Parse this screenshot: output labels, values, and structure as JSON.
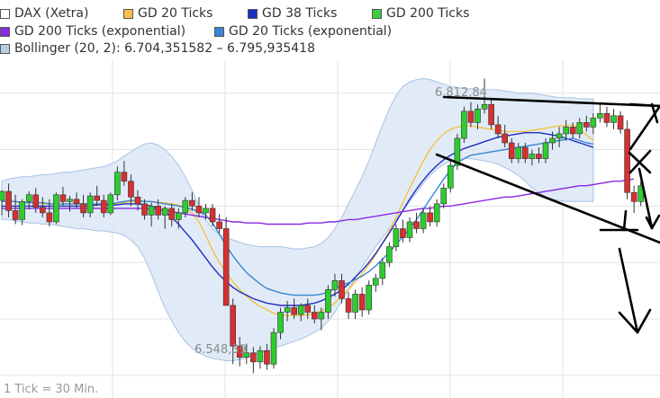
{
  "legend": {
    "items": [
      {
        "label": "DAX (Xetra)",
        "color": "#ffffff"
      },
      {
        "label": "GD 20 Ticks",
        "color": "#f5c243"
      },
      {
        "label": "GD 38 Ticks",
        "color": "#1f2ec4"
      },
      {
        "label": "GD 200 Ticks",
        "color": "#3fcc3f"
      },
      {
        "label": "GD 200 Ticks (exponential)",
        "color": "#8a2be2"
      },
      {
        "label": "GD 20 Ticks (exponential)",
        "color": "#3a86d4"
      },
      {
        "label": "Bollinger (20, 2): 6.704,351582 – 6.795,935418",
        "color": "#b7cde8"
      }
    ]
  },
  "annotations": {
    "high": "6.812,84",
    "low": "6.548,39"
  },
  "footer": {
    "tick_note": "1 Tick = 30 Min."
  },
  "chart_data": {
    "type": "candlestick",
    "title": "",
    "xlabel": "",
    "ylabel": "",
    "ylim": [
      6530,
      6830
    ],
    "grid": true,
    "legend_position": "top-left",
    "colors": {
      "up": "#2ecc2e",
      "down": "#d63030",
      "bollinger_fill": "#dbe7f6",
      "bollinger_edge": "#a9c2e4"
    },
    "candles": [
      [
        6705,
        6714,
        6692,
        6713
      ],
      [
        6713,
        6720,
        6690,
        6696
      ],
      [
        6696,
        6710,
        6684,
        6688
      ],
      [
        6688,
        6706,
        6683,
        6704
      ],
      [
        6704,
        6713,
        6697,
        6710
      ],
      [
        6710,
        6716,
        6694,
        6699
      ],
      [
        6699,
        6708,
        6690,
        6694
      ],
      [
        6694,
        6706,
        6682,
        6686
      ],
      [
        6686,
        6712,
        6684,
        6710
      ],
      [
        6710,
        6717,
        6700,
        6704
      ],
      [
        6704,
        6709,
        6695,
        6706
      ],
      [
        6706,
        6712,
        6698,
        6702
      ],
      [
        6702,
        6710,
        6690,
        6694
      ],
      [
        6694,
        6712,
        6690,
        6709
      ],
      [
        6709,
        6718,
        6700,
        6705
      ],
      [
        6705,
        6710,
        6690,
        6694
      ],
      [
        6694,
        6712,
        6692,
        6710
      ],
      [
        6710,
        6735,
        6705,
        6730
      ],
      [
        6730,
        6740,
        6718,
        6722
      ],
      [
        6722,
        6728,
        6700,
        6708
      ],
      [
        6708,
        6714,
        6696,
        6702
      ],
      [
        6702,
        6706,
        6688,
        6692
      ],
      [
        6692,
        6703,
        6682,
        6700
      ],
      [
        6700,
        6706,
        6688,
        6692
      ],
      [
        6692,
        6700,
        6680,
        6698
      ],
      [
        6698,
        6702,
        6682,
        6688
      ],
      [
        6688,
        6698,
        6680,
        6694
      ],
      [
        6694,
        6708,
        6690,
        6705
      ],
      [
        6705,
        6712,
        6696,
        6700
      ],
      [
        6700,
        6708,
        6690,
        6694
      ],
      [
        6694,
        6702,
        6688,
        6698
      ],
      [
        6698,
        6702,
        6682,
        6686
      ],
      [
        6686,
        6693,
        6676,
        6680
      ],
      [
        6680,
        6690,
        6640,
        6612
      ],
      [
        6612,
        6618,
        6560,
        6576
      ],
      [
        6576,
        6584,
        6558,
        6566
      ],
      [
        6566,
        6578,
        6560,
        6570
      ],
      [
        6570,
        6575,
        6552,
        6562
      ],
      [
        6562,
        6576,
        6556,
        6572
      ],
      [
        6572,
        6578,
        6555,
        6560
      ],
      [
        6560,
        6592,
        6556,
        6588
      ],
      [
        6588,
        6610,
        6582,
        6606
      ],
      [
        6606,
        6616,
        6598,
        6610
      ],
      [
        6610,
        6618,
        6600,
        6604
      ],
      [
        6604,
        6614,
        6598,
        6612
      ],
      [
        6612,
        6618,
        6600,
        6606
      ],
      [
        6606,
        6612,
        6596,
        6600
      ],
      [
        6600,
        6610,
        6590,
        6606
      ],
      [
        6606,
        6630,
        6600,
        6626
      ],
      [
        6626,
        6640,
        6620,
        6634
      ],
      [
        6634,
        6640,
        6614,
        6618
      ],
      [
        6618,
        6624,
        6600,
        6606
      ],
      [
        6606,
        6626,
        6600,
        6622
      ],
      [
        6622,
        6628,
        6602,
        6608
      ],
      [
        6608,
        6634,
        6604,
        6630
      ],
      [
        6630,
        6640,
        6624,
        6636
      ],
      [
        6636,
        6654,
        6630,
        6650
      ],
      [
        6650,
        6668,
        6646,
        6664
      ],
      [
        6664,
        6684,
        6660,
        6680
      ],
      [
        6680,
        6688,
        6668,
        6672
      ],
      [
        6672,
        6690,
        6668,
        6686
      ],
      [
        6686,
        6694,
        6676,
        6680
      ],
      [
        6680,
        6698,
        6676,
        6694
      ],
      [
        6694,
        6700,
        6682,
        6686
      ],
      [
        6686,
        6706,
        6682,
        6702
      ],
      [
        6702,
        6720,
        6698,
        6716
      ],
      [
        6716,
        6740,
        6712,
        6736
      ],
      [
        6736,
        6764,
        6732,
        6760
      ],
      [
        6760,
        6788,
        6756,
        6784
      ],
      [
        6784,
        6792,
        6770,
        6774
      ],
      [
        6774,
        6790,
        6768,
        6786
      ],
      [
        6786,
        6813,
        6782,
        6790
      ],
      [
        6790,
        6796,
        6768,
        6772
      ],
      [
        6772,
        6780,
        6760,
        6764
      ],
      [
        6764,
        6772,
        6752,
        6756
      ],
      [
        6756,
        6760,
        6738,
        6742
      ],
      [
        6742,
        6756,
        6738,
        6752
      ],
      [
        6752,
        6756,
        6738,
        6742
      ],
      [
        6742,
        6750,
        6736,
        6746
      ],
      [
        6746,
        6752,
        6738,
        6742
      ],
      [
        6742,
        6760,
        6738,
        6756
      ],
      [
        6756,
        6766,
        6750,
        6760
      ],
      [
        6760,
        6770,
        6752,
        6764
      ],
      [
        6764,
        6776,
        6758,
        6770
      ],
      [
        6770,
        6774,
        6760,
        6764
      ],
      [
        6764,
        6778,
        6760,
        6774
      ],
      [
        6774,
        6780,
        6766,
        6770
      ],
      [
        6770,
        6782,
        6764,
        6778
      ],
      [
        6778,
        6790,
        6774,
        6782
      ],
      [
        6782,
        6788,
        6770,
        6774
      ],
      [
        6774,
        6786,
        6768,
        6780
      ],
      [
        6780,
        6784,
        6764,
        6768
      ],
      [
        6768,
        6776,
        6706,
        6712
      ],
      [
        6712,
        6718,
        6694,
        6704
      ],
      [
        6704,
        6722,
        6700,
        6718
      ]
    ],
    "series": [
      {
        "name": "GD 20 Ticks",
        "values": [
          6706,
          6705,
          6704,
          6703,
          6703,
          6703,
          6702,
          6702,
          6702,
          6702,
          6702,
          6702,
          6702,
          6701,
          6702,
          6701,
          6701,
          6702,
          6703,
          6704,
          6704,
          6704,
          6704,
          6703,
          6703,
          6702,
          6701,
          6699,
          6694,
          6686,
          6674,
          6661,
          6650,
          6641,
          6633,
          6626,
          6620,
          6615,
          6611,
          6608,
          6605,
          6604,
          6603,
          6603,
          6603,
          6604,
          6605,
          6607,
          6610,
          6614,
          6620,
          6626,
          6633,
          6640,
          6648,
          6657,
          6667,
          6678,
          6690,
          6703,
          6716,
          6728,
          6740,
          6750,
          6758,
          6764,
          6768,
          6770,
          6771,
          6771,
          6770,
          6769,
          6768,
          6767,
          6766,
          6766,
          6766,
          6766,
          6767,
          6768,
          6769,
          6770,
          6771,
          6771,
          6772,
          6768,
          6763,
          6758
        ]
      },
      {
        "name": "GD 38 Ticks",
        "values": [
          6700,
          6700,
          6700,
          6700,
          6700,
          6700,
          6700,
          6700,
          6700,
          6700,
          6700,
          6700,
          6700,
          6700,
          6701,
          6701,
          6701,
          6701,
          6702,
          6702,
          6702,
          6701,
          6700,
          6698,
          6695,
          6690,
          6684,
          6677,
          6670,
          6662,
          6654,
          6646,
          6639,
          6633,
          6628,
          6624,
          6621,
          6618,
          6616,
          6614,
          6613,
          6612,
          6612,
          6612,
          6612,
          6613,
          6614,
          6616,
          6619,
          6622,
          6626,
          6631,
          6637,
          6643,
          6650,
          6658,
          6667,
          6676,
          6686,
          6696,
          6706,
          6715,
          6723,
          6730,
          6736,
          6741,
          6745,
          6748,
          6751,
          6753,
          6755,
          6757,
          6759,
          6761,
          6762,
          6763,
          6764,
          6765,
          6765,
          6765,
          6764,
          6763,
          6762,
          6760,
          6758,
          6756,
          6754,
          6752
        ]
      },
      {
        "name": "GD 200 Ticks (exponential)",
        "values": [
          6698,
          6698,
          6698,
          6698,
          6698,
          6698,
          6698,
          6698,
          6698,
          6698,
          6698,
          6698,
          6698,
          6698,
          6698,
          6698,
          6698,
          6698,
          6698,
          6698,
          6698,
          6698,
          6697,
          6697,
          6696,
          6695,
          6694,
          6693,
          6692,
          6691,
          6690,
          6689,
          6688,
          6687,
          6686,
          6686,
          6685,
          6685,
          6685,
          6684,
          6684,
          6684,
          6684,
          6684,
          6684,
          6685,
          6685,
          6685,
          6686,
          6686,
          6687,
          6688,
          6688,
          6689,
          6690,
          6691,
          6692,
          6693,
          6694,
          6695,
          6696,
          6697,
          6698,
          6698,
          6699,
          6700,
          6700,
          6701,
          6702,
          6703,
          6704,
          6705,
          6706,
          6707,
          6708,
          6708,
          6709,
          6710,
          6711,
          6712,
          6713,
          6714,
          6715,
          6716,
          6717,
          6718,
          6718,
          6719,
          6720,
          6721,
          6722,
          6722,
          6723,
          6724
        ]
      },
      {
        "name": "GD 20 Ticks (exponential)",
        "values": [
          6704,
          6704,
          6704,
          6703,
          6703,
          6703,
          6703,
          6702,
          6702,
          6702,
          6702,
          6702,
          6702,
          6702,
          6702,
          6702,
          6702,
          6703,
          6704,
          6705,
          6705,
          6704,
          6704,
          6703,
          6702,
          6701,
          6700,
          6699,
          6697,
          6695,
          6692,
          6685,
          6675,
          6665,
          6656,
          6648,
          6641,
          6636,
          6631,
          6627,
          6625,
          6623,
          6622,
          6621,
          6621,
          6621,
          6621,
          6622,
          6624,
          6627,
          6630,
          6632,
          6635,
          6638,
          6642,
          6647,
          6653,
          6659,
          6666,
          6673,
          6680,
          6688,
          6697,
          6706,
          6715,
          6724,
          6732,
          6738,
          6742,
          6745,
          6746,
          6747,
          6748,
          6749,
          6750,
          6751,
          6752,
          6753,
          6754,
          6755,
          6756,
          6757,
          6758,
          6759,
          6760,
          6758,
          6756,
          6755
        ]
      }
    ],
    "bollinger": {
      "upper": [
        6722,
        6724,
        6725,
        6726,
        6726,
        6727,
        6728,
        6728,
        6729,
        6730,
        6730,
        6731,
        6732,
        6733,
        6734,
        6735,
        6737,
        6740,
        6744,
        6748,
        6752,
        6755,
        6756,
        6754,
        6750,
        6744,
        6736,
        6726,
        6714,
        6700,
        6688,
        6680,
        6675,
        6672,
        6670,
        6668,
        6666,
        6665,
        6664,
        6664,
        6664,
        6664,
        6663,
        6662,
        6662,
        6663,
        6664,
        6667,
        6672,
        6680,
        6690,
        6702,
        6714,
        6726,
        6740,
        6756,
        6772,
        6786,
        6798,
        6806,
        6810,
        6812,
        6813,
        6812,
        6810,
        6808,
        6806,
        6805,
        6804,
        6804,
        6803,
        6803,
        6803,
        6803,
        6802,
        6801,
        6800,
        6800,
        6800,
        6799,
        6798,
        6797,
        6796,
        6796,
        6796,
        6795,
        6795,
        6795
      ],
      "lower": [
        6688,
        6688,
        6687,
        6686,
        6685,
        6685,
        6684,
        6684,
        6683,
        6682,
        6681,
        6680,
        6680,
        6679,
        6678,
        6678,
        6677,
        6676,
        6674,
        6670,
        6664,
        6654,
        6640,
        6624,
        6610,
        6598,
        6588,
        6580,
        6574,
        6570,
        6567,
        6565,
        6564,
        6563,
        6563,
        6564,
        6566,
        6568,
        6570,
        6572,
        6574,
        6576,
        6578,
        6580,
        6582,
        6585,
        6588,
        6592,
        6598,
        6606,
        6616,
        6626,
        6636,
        6646,
        6655,
        6664,
        6672,
        6680,
        6688,
        6696,
        6704,
        6712,
        6720,
        6727,
        6733,
        6737,
        6740,
        6741,
        6742,
        6742,
        6741,
        6740,
        6739,
        6737,
        6734,
        6731,
        6727,
        6722,
        6716,
        6712,
        6708,
        6706,
        6705,
        6704,
        6704,
        6704,
        6704,
        6704
      ]
    }
  }
}
